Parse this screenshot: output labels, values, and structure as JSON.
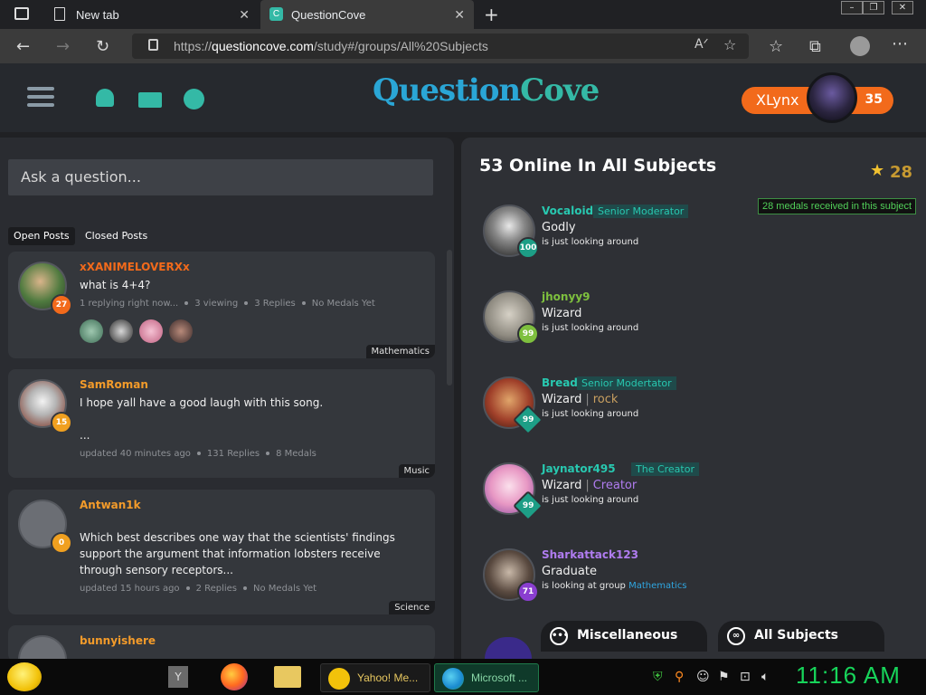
{
  "browser": {
    "tabs": [
      {
        "title": "New tab"
      },
      {
        "title": "QuestionCove"
      }
    ],
    "url_prefix": "https://",
    "url_domain": "questioncove.com",
    "url_path": "/study#/groups/All%20Subjects"
  },
  "header": {
    "logo_main": "Question",
    "logo_cove": "Cove",
    "username": "XLynx",
    "user_score": "35"
  },
  "left": {
    "ask_placeholder": "Ask a question...",
    "tabs": {
      "open": "Open Posts",
      "closed": "Closed Posts"
    },
    "posts": [
      {
        "author": "xXANIMELOVERXx",
        "level": "27",
        "text": "what is 4+4?",
        "meta": [
          "1 replying right now...",
          "3 viewing",
          "3 Replies",
          "No Medals Yet"
        ],
        "subject": "Mathematics"
      },
      {
        "author": "SamRoman",
        "level": "15",
        "text": "I hope yall have a good laugh with this song.",
        "text2": "...",
        "meta": [
          "updated 40 minutes ago",
          "131 Replies",
          "8 Medals"
        ],
        "subject": "Music"
      },
      {
        "author": "Antwan1k",
        "level": "0",
        "text": "Which best describes one way that the scientists' findings support the argument that information lobsters receive through sensory receptors...",
        "meta": [
          "updated 15 hours ago",
          "2 Replies",
          "No Medals Yet"
        ],
        "subject": "Science"
      },
      {
        "author": "bunnyishere"
      }
    ]
  },
  "right": {
    "title": "53 Online In All Subjects",
    "medal_count": "28",
    "medal_tooltip": "28 medals received in this subject",
    "users": [
      {
        "name": "Vocaloid",
        "name_color": "#28c8b0",
        "role": "Senior Moderator",
        "level": "100",
        "rank": "Godly",
        "rank_extra": "",
        "status": "is just looking around",
        "group": ""
      },
      {
        "name": "jhonyy9",
        "name_color": "#7ec03e",
        "role": "",
        "level": "99",
        "rank": "Wizard",
        "rank_extra": "",
        "status": "is just looking around",
        "group": ""
      },
      {
        "name": "Bread",
        "name_color": "#28c8b0",
        "role": "Senior Modertator",
        "level": "99",
        "rank": "Wizard",
        "rank_extra": "rock",
        "status": "is just looking around",
        "group": ""
      },
      {
        "name": "Jaynator495",
        "name_color": "#28c8b0",
        "role": "The Creator",
        "level": "99",
        "rank": "Wizard",
        "rank_extra": "Creator",
        "status": "is just looking around",
        "group": ""
      },
      {
        "name": "Sharkattack123",
        "name_color": "#b07cf0",
        "role": "",
        "level": "71",
        "rank": "Graduate",
        "rank_extra": "",
        "status": "is looking at group",
        "group": "Mathematics"
      }
    ],
    "buttons": {
      "misc": "Miscellaneous",
      "all": "All Subjects"
    }
  },
  "taskbar": {
    "items": [
      {
        "label": "Yahoo! Me..."
      },
      {
        "label": "Microsoft ..."
      }
    ],
    "clock": "11:16 AM"
  },
  "colors": {
    "accent_orange": "#f26a1b",
    "teal": "#28c8b0",
    "logo_blue": "#2aa6d6",
    "clock_green": "#17d45a"
  }
}
